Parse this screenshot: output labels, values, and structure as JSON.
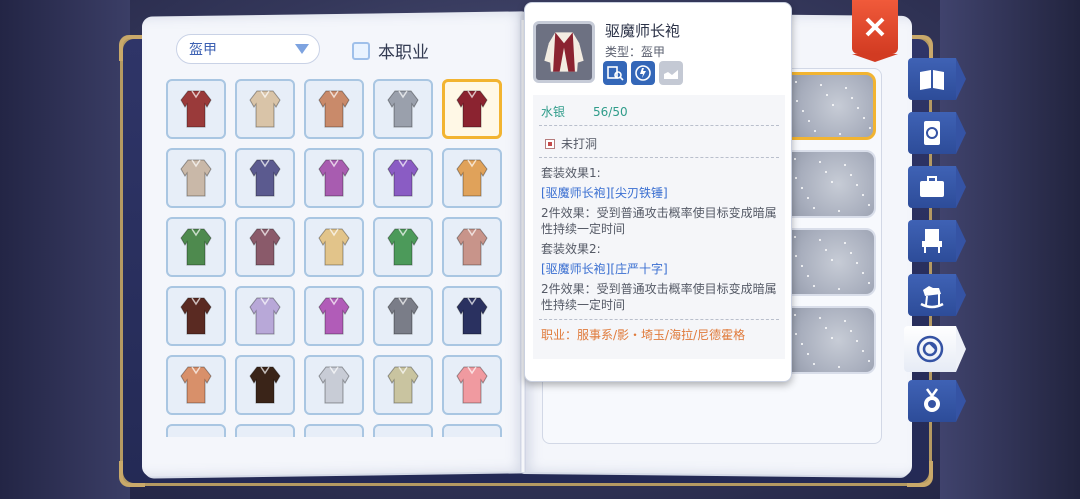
{
  "filter": {
    "category": "盔甲",
    "job_only_label": "本职业"
  },
  "item_grid": {
    "rows": [
      [
        {
          "name": "red-dotted-shirt"
        },
        {
          "name": "cream-fur-coat"
        },
        {
          "name": "red-vest"
        },
        {
          "name": "chain-mail"
        },
        {
          "name": "exorcist-robe",
          "selected": true
        }
      ],
      [
        {
          "name": "light-armor"
        },
        {
          "name": "purple-dotted-shirt"
        },
        {
          "name": "purple-dress"
        },
        {
          "name": "purple-coat"
        },
        {
          "name": "orange-cape"
        }
      ],
      [
        {
          "name": "green-dotted-shirt"
        },
        {
          "name": "dotted-shirt"
        },
        {
          "name": "yellow-cloth"
        },
        {
          "name": "green-robe"
        },
        {
          "name": "pink-suit"
        }
      ],
      [
        {
          "name": "brown-robe"
        },
        {
          "name": "lavender-coat"
        },
        {
          "name": "magenta-robe"
        },
        {
          "name": "silver-plate"
        },
        {
          "name": "navy-robe"
        }
      ],
      [
        {
          "name": "orange-harness"
        },
        {
          "name": "leather-coat"
        },
        {
          "name": "white-plate"
        },
        {
          "name": "mesh-coat"
        },
        {
          "name": "pink-fur-dress"
        }
      ]
    ]
  },
  "tooltip": {
    "name": "驱魔师长袍",
    "type": "类型：盔甲",
    "stat_name": "水银",
    "stat_value": "56/50",
    "slot": "未打洞",
    "set1_title": "套装效果1:",
    "set1_item": "[驱魔师长袍][尖刃铁锤]",
    "set1_desc": "2件效果：受到普通攻击概率使目标变成暗属性持续一定时间",
    "set2_title": "套装效果2:",
    "set2_item": "[驱魔师长袍][庄严十字]",
    "set2_desc": "2件效果：受到普通攻击概率使目标变成暗属性持续一定时间",
    "job": "职业：服事系/影・埼玉/海拉/尼德霍格"
  },
  "side_tabs": [
    {
      "name": "book"
    },
    {
      "name": "card"
    },
    {
      "name": "briefcase"
    },
    {
      "name": "chair"
    },
    {
      "name": "rocking-horse"
    },
    {
      "name": "costume",
      "active": true
    },
    {
      "name": "medal"
    }
  ],
  "colors": {
    "accent": "#3467b8",
    "selected": "#f2b431",
    "close": "#e04a2e",
    "stat": "#2f9c8a",
    "link": "#3a6fd1",
    "job": "#e07a3a"
  }
}
